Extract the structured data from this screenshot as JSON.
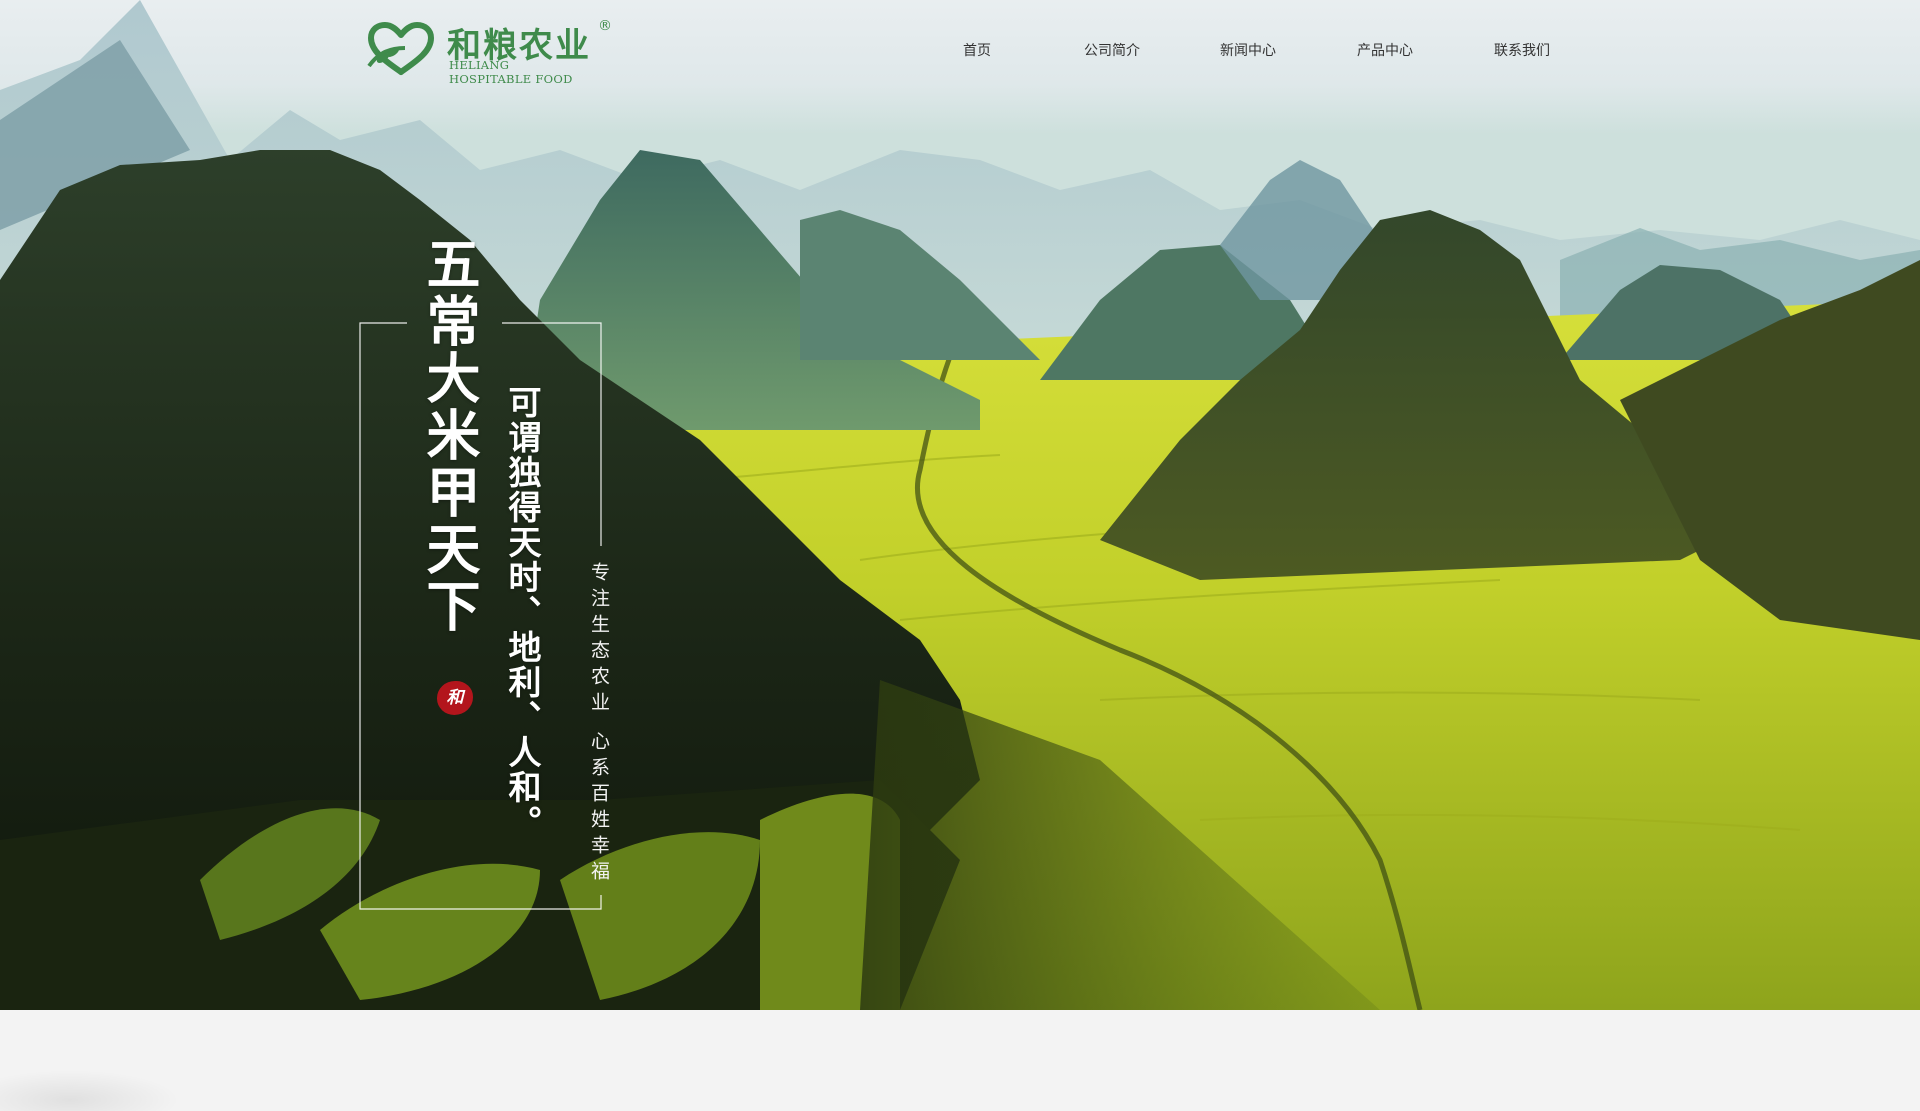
{
  "brand": {
    "name_cn": "和粮农业",
    "registered_mark": "®",
    "name_en_line1": "HELIANG",
    "name_en_line2": "HOSPITABLE FOOD",
    "color": "#3f8b4b"
  },
  "nav": {
    "items": [
      {
        "label": "首页"
      },
      {
        "label": "公司简介"
      },
      {
        "label": "新闻中心"
      },
      {
        "label": "产品中心"
      },
      {
        "label": "联系我们"
      }
    ]
  },
  "hero": {
    "headline": "五常大米甲天下",
    "subline": "可谓独得天时、地利、人和。",
    "tagline_1": "专注生态农业",
    "tagline_2": "心系百姓幸福",
    "seal_text": "和",
    "seal_color": "#b3151c",
    "background_scene": "karst-mountains-rapeseed-fields-photo"
  }
}
